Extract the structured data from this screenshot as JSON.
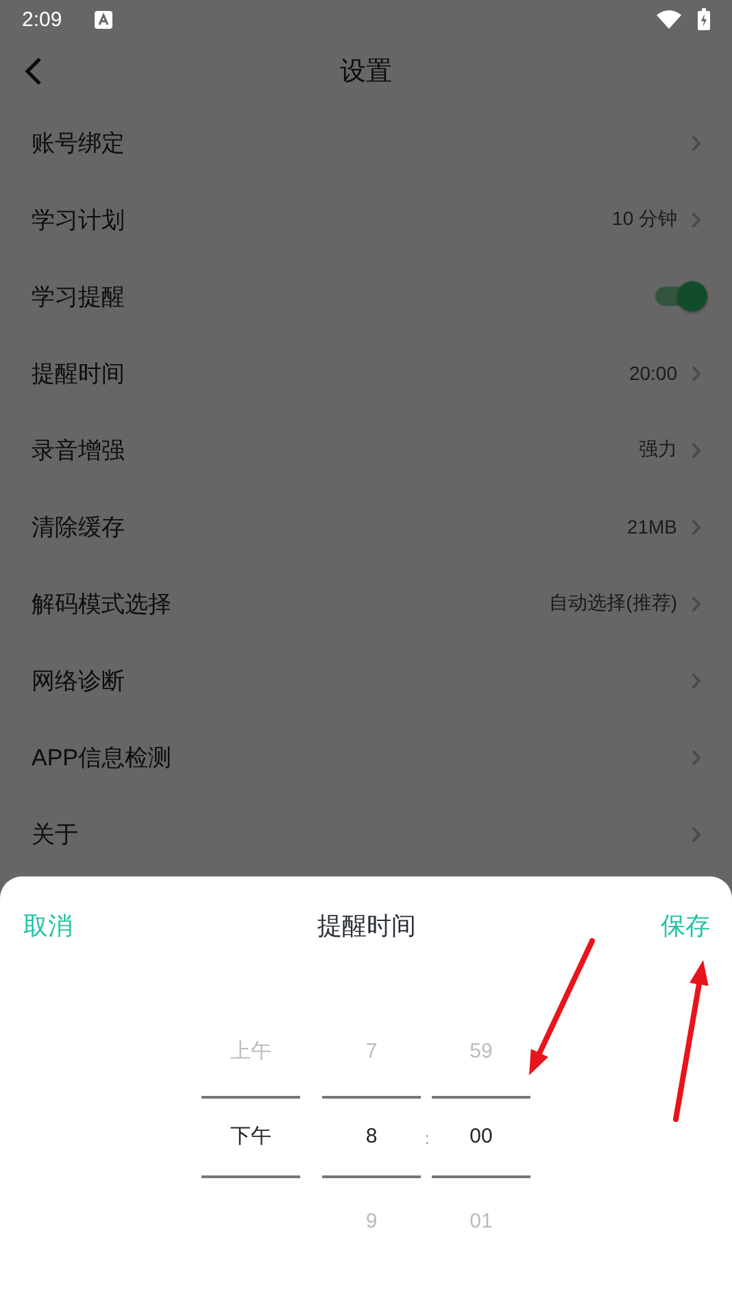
{
  "status_bar": {
    "time": "2:09"
  },
  "header": {
    "title": "设置"
  },
  "settings": [
    {
      "kind": "link",
      "label": "账号绑定"
    },
    {
      "kind": "link",
      "label": "学习计划",
      "value": "10 分钟"
    },
    {
      "kind": "toggle",
      "label": "学习提醒",
      "on": true
    },
    {
      "kind": "link",
      "label": "提醒时间",
      "value": "20:00"
    },
    {
      "kind": "link",
      "label": "录音增强",
      "value": "强力"
    },
    {
      "kind": "link",
      "label": "清除缓存",
      "value": "21MB"
    },
    {
      "kind": "link",
      "label": "解码模式选择",
      "value": "自动选择(推荐)"
    },
    {
      "kind": "link",
      "label": "网络诊断"
    },
    {
      "kind": "link",
      "label": "APP信息检测"
    },
    {
      "kind": "link",
      "label": "关于"
    }
  ],
  "sheet": {
    "cancel": "取消",
    "title": "提醒时间",
    "save": "保存",
    "separator": ":",
    "columns": [
      {
        "items": [
          {
            "text": "上午",
            "selected": false
          },
          {
            "text": "下午",
            "selected": true
          }
        ]
      },
      {
        "items": [
          {
            "text": "7",
            "selected": false
          },
          {
            "text": "8",
            "selected": true
          },
          {
            "text": "9",
            "selected": false
          }
        ]
      },
      {
        "items": [
          {
            "text": "59",
            "selected": false
          },
          {
            "text": "00",
            "selected": true
          },
          {
            "text": "01",
            "selected": false
          }
        ]
      }
    ]
  },
  "annotations": [
    {
      "kind": "arrow"
    },
    {
      "kind": "arrow"
    }
  ]
}
